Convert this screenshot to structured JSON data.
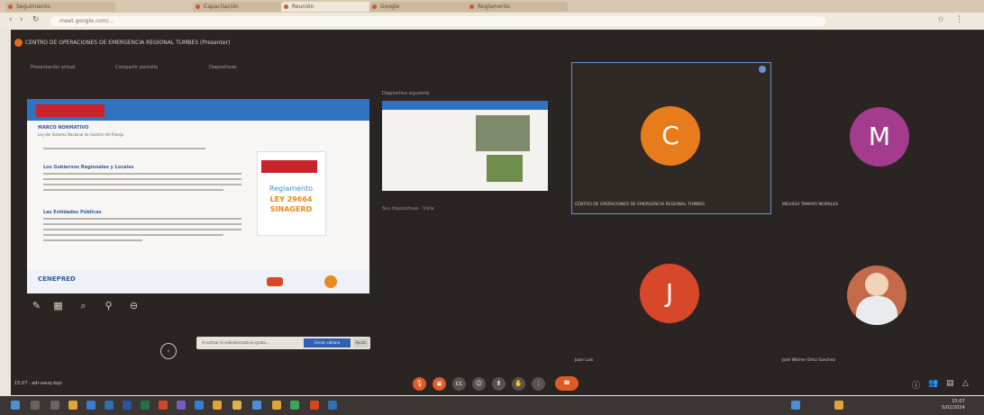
{
  "browser": {
    "tabs": [
      "Seguimiento",
      "Capacitación",
      "Reunión",
      "Google",
      "Reglamento"
    ],
    "url": "meet.google.com/..."
  },
  "meeting": {
    "title": "CENTRO DE OPERACIONES DE EMERGENCIA REGIONAL TUMBES (Presenter)",
    "menu": [
      "Presentación actual",
      "Compartir pantalla",
      "Diapositivas"
    ],
    "time": "15:07 · adr-eauq-bqo"
  },
  "slide": {
    "agency": "CENEPRED",
    "section_title": "MARCO NORMATIVO",
    "subtitle": "Ley del Sistema Nacional de Gestión del Riesgo",
    "block1_title": "Los Gobiernos Regionales y Locales",
    "block2_title": "Las Entidades Públicas",
    "promo_line1": "Reglamento",
    "promo_line2": "LEY 29664",
    "promo_line3": "SINAGERD",
    "footer": "CENEPRED"
  },
  "thumbnail": {
    "label": "Diapositiva siguiente",
    "caption": "Sus diapositivas · Vista"
  },
  "participants": [
    {
      "initial": "C",
      "name": "CENTRO DE OPERACIONES DE EMERGENCIA REGIONAL TUMBES",
      "color": "#e87c1c"
    },
    {
      "initial": "M",
      "name": "MELISSA TAMAYO MORALES",
      "color": "#a53b8f"
    },
    {
      "initial": "J",
      "name": "Juan Luis",
      "color": "#d8472a"
    },
    {
      "initial": "",
      "name": "José Wilmer Ortiz Sanchez",
      "color": "#c46a4a"
    }
  ],
  "consent": {
    "text": "Al activar la videollamada se graba...",
    "accept": "Cerrar cámara",
    "dismiss": "Ayuda"
  },
  "taskbar": {
    "clock_time": "15:07",
    "clock_date": "5/02/2024"
  }
}
